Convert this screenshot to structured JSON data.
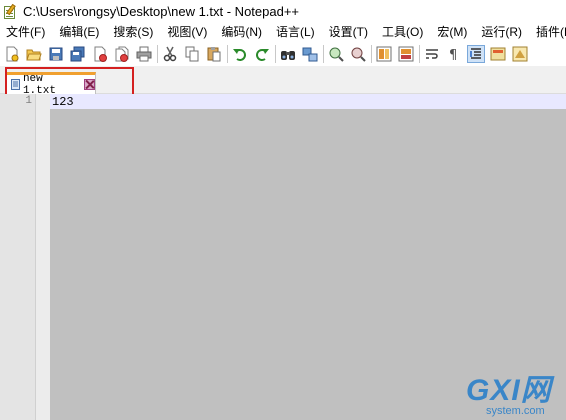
{
  "window": {
    "title": "C:\\Users\\rongsy\\Desktop\\new 1.txt - Notepad++"
  },
  "menubar": {
    "items": [
      "文件(F)",
      "编辑(E)",
      "搜索(S)",
      "视图(V)",
      "编码(N)",
      "语言(L)",
      "设置(T)",
      "工具(O)",
      "宏(M)",
      "运行(R)",
      "插件(P)"
    ]
  },
  "toolbar": {
    "icons": [
      "new-file-icon",
      "open-file-icon",
      "save-icon",
      "save-all-icon",
      "close-icon",
      "close-all-icon",
      "print-icon",
      "cut-icon",
      "copy-icon",
      "paste-icon",
      "undo-icon",
      "redo-icon",
      "find-icon",
      "replace-icon",
      "zoom-in-icon",
      "zoom-out-icon",
      "sync-vertical-icon",
      "sync-horizontal-icon",
      "word-wrap-icon",
      "show-all-chars-icon",
      "indent-guide-icon",
      "user-language-icon",
      "doc-map-icon"
    ]
  },
  "tabs": [
    {
      "label": "new 1.txt"
    }
  ],
  "editor": {
    "lines": [
      {
        "number": "1",
        "text": "123"
      }
    ]
  },
  "watermark": {
    "main": "GXI网",
    "sub": "system.com"
  },
  "colors": {
    "editor_background": "#c0c0c0",
    "current_line": "#e8e8ff",
    "gutter": "#e4e4e4",
    "highlight_box": "#d42020",
    "tab_accent": "#f0a030",
    "watermark": "#3a86c8"
  }
}
